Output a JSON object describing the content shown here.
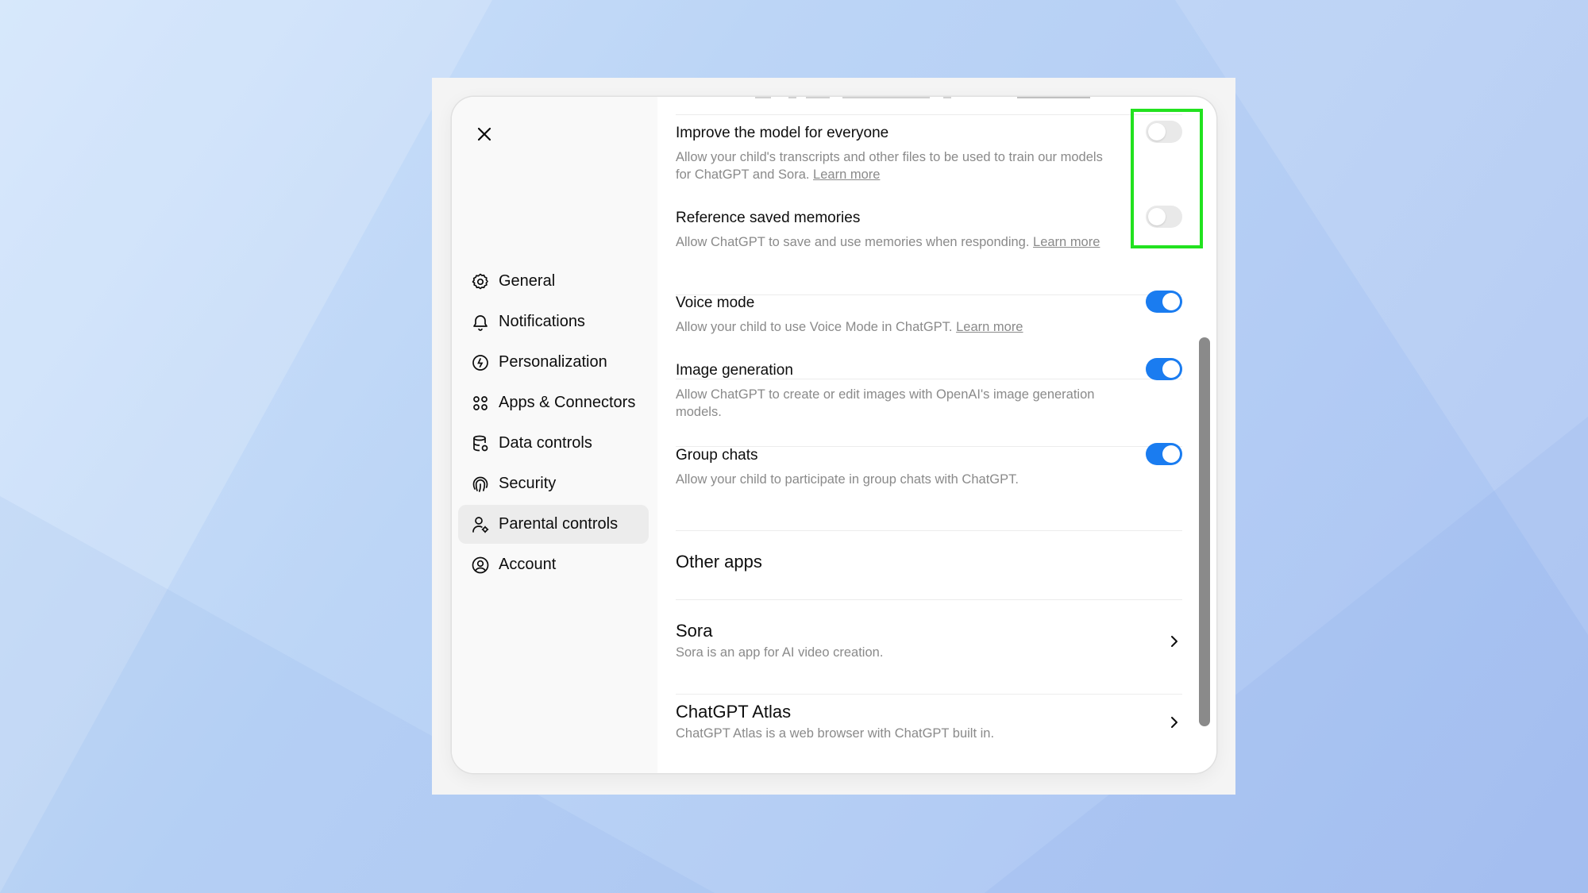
{
  "sidebar": {
    "close_icon": "close-icon",
    "items": [
      {
        "label": "General",
        "icon": "gear-icon",
        "active": false
      },
      {
        "label": "Notifications",
        "icon": "bell-icon",
        "active": false
      },
      {
        "label": "Personalization",
        "icon": "personalization-icon",
        "active": false
      },
      {
        "label": "Apps & Connectors",
        "icon": "apps-grid-icon",
        "active": false
      },
      {
        "label": "Data controls",
        "icon": "database-icon",
        "active": false
      },
      {
        "label": "Security",
        "icon": "fingerprint-icon",
        "active": false
      },
      {
        "label": "Parental controls",
        "icon": "parental-user-icon",
        "active": true
      },
      {
        "label": "Account",
        "icon": "account-circle-icon",
        "active": false
      }
    ]
  },
  "settings": [
    {
      "title": "Improve the model for everyone",
      "desc": "Allow your child's transcripts and other files to be used to train our models for ChatGPT and Sora.",
      "link": "Learn more",
      "enabled": false
    },
    {
      "title": "Reference saved memories",
      "desc": "Allow ChatGPT to save and use memories when responding.",
      "link": "Learn more",
      "enabled": false
    },
    {
      "title": "Voice mode",
      "desc": "Allow your child to use Voice Mode in ChatGPT.",
      "link": "Learn more",
      "enabled": true
    },
    {
      "title": "Image generation",
      "desc": "Allow ChatGPT to create or edit images with OpenAI's image generation models.",
      "link": "",
      "enabled": true
    },
    {
      "title": "Group chats",
      "desc": "Allow your child to participate in group chats with ChatGPT.",
      "link": "",
      "enabled": true
    }
  ],
  "other_apps": {
    "heading": "Other apps",
    "apps": [
      {
        "title": "Sora",
        "desc": "Sora is an app for AI video creation."
      },
      {
        "title": "ChatGPT Atlas",
        "desc": "ChatGPT Atlas is a web browser with ChatGPT built in."
      }
    ]
  },
  "colors": {
    "toggle_on": "#1a7cf0",
    "toggle_off": "#e9e9e9",
    "highlight": "#22e21f"
  }
}
